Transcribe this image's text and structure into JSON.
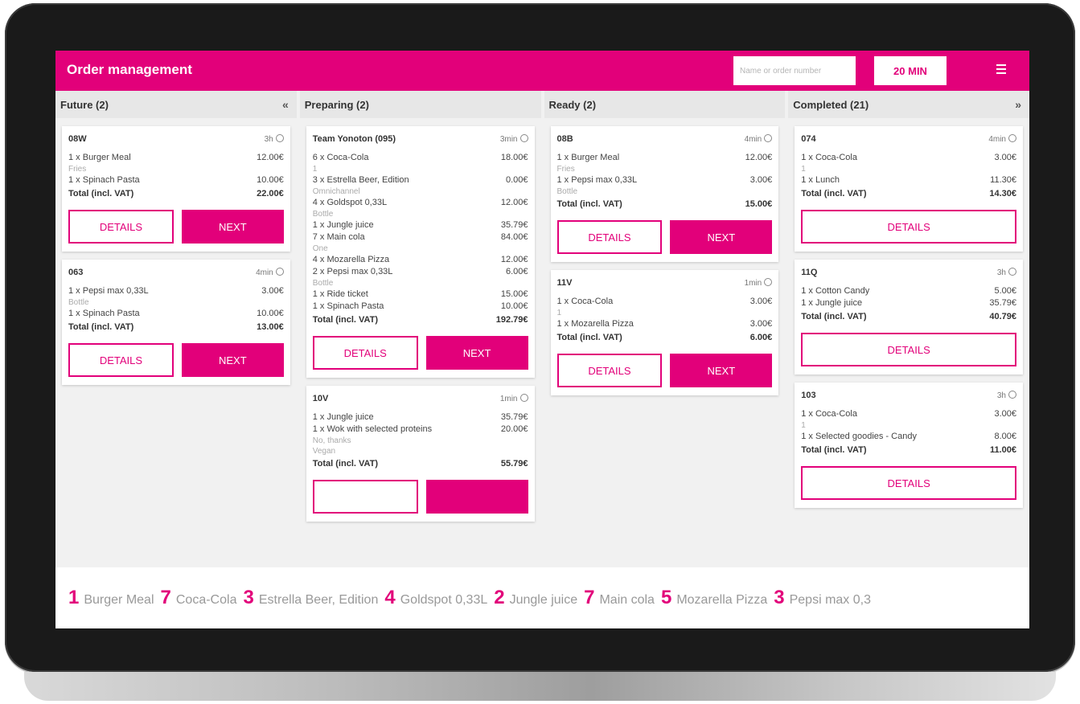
{
  "header": {
    "title": "Order management",
    "search_placeholder": "Name or order number",
    "time_button": "20 MIN",
    "menu_icon": "hamburger-icon"
  },
  "columns": [
    {
      "title": "Future (2)",
      "collapse_icon": "«",
      "cards": [
        {
          "id": "08W",
          "time": "3h",
          "lines": [
            {
              "item": "1 x Burger Meal",
              "price": "12.00€",
              "note": "Fries"
            },
            {
              "item": "1 x Spinach Pasta",
              "price": "10.00€",
              "note": ""
            }
          ],
          "total_label": "Total (incl. VAT)",
          "total": "22.00€",
          "buttons": [
            "DETAILS",
            "NEXT"
          ]
        },
        {
          "id": "063",
          "time": "4min",
          "lines": [
            {
              "item": "1 x Pepsi max 0,33L",
              "price": "3.00€",
              "note": "Bottle"
            },
            {
              "item": "1 x Spinach Pasta",
              "price": "10.00€",
              "note": ""
            }
          ],
          "total_label": "Total (incl. VAT)",
          "total": "13.00€",
          "buttons": [
            "DETAILS",
            "NEXT"
          ]
        }
      ]
    },
    {
      "title": "Preparing (2)",
      "collapse_icon": "",
      "cards": [
        {
          "id": "Team Yonoton (095)",
          "time": "3min",
          "lines": [
            {
              "item": "6 x Coca-Cola",
              "price": "18.00€",
              "note": "1"
            },
            {
              "item": "3 x Estrella Beer, Edition",
              "price": "0.00€",
              "note": "Omnichannel"
            },
            {
              "item": "4 x Goldspot 0,33L",
              "price": "12.00€",
              "note": "Bottle"
            },
            {
              "item": "1 x Jungle juice",
              "price": "35.79€",
              "note": ""
            },
            {
              "item": "7 x Main cola",
              "price": "84.00€",
              "note": "One"
            },
            {
              "item": "4 x Mozarella Pizza",
              "price": "12.00€",
              "note": ""
            },
            {
              "item": "2 x Pepsi max 0,33L",
              "price": "6.00€",
              "note": "Bottle"
            },
            {
              "item": "1 x Ride ticket",
              "price": "15.00€",
              "note": ""
            },
            {
              "item": "1 x Spinach Pasta",
              "price": "10.00€",
              "note": ""
            }
          ],
          "total_label": "Total (incl. VAT)",
          "total": "192.79€",
          "buttons": [
            "DETAILS",
            "NEXT"
          ]
        },
        {
          "id": "10V",
          "time": "1min",
          "lines": [
            {
              "item": "1 x Jungle juice",
              "price": "35.79€",
              "note": ""
            },
            {
              "item": "1 x Wok with selected proteins",
              "price": "20.00€",
              "note": "No, thanks\nVegan"
            }
          ],
          "total_label": "Total (incl. VAT)",
          "total": "55.79€",
          "buttons": [
            "",
            ""
          ]
        }
      ]
    },
    {
      "title": "Ready (2)",
      "collapse_icon": "",
      "cards": [
        {
          "id": "08B",
          "time": "4min",
          "lines": [
            {
              "item": "1 x Burger Meal",
              "price": "12.00€",
              "note": "Fries"
            },
            {
              "item": "1 x Pepsi max 0,33L",
              "price": "3.00€",
              "note": "Bottle"
            }
          ],
          "total_label": "Total (incl. VAT)",
          "total": "15.00€",
          "buttons": [
            "DETAILS",
            "NEXT"
          ]
        },
        {
          "id": "11V",
          "time": "1min",
          "lines": [
            {
              "item": "1 x Coca-Cola",
              "price": "3.00€",
              "note": "1"
            },
            {
              "item": "1 x Mozarella Pizza",
              "price": "3.00€",
              "note": ""
            }
          ],
          "total_label": "Total (incl. VAT)",
          "total": "6.00€",
          "buttons": [
            "DETAILS",
            "NEXT"
          ]
        }
      ]
    },
    {
      "title": "Completed (21)",
      "collapse_icon": "»",
      "cards": [
        {
          "id": "074",
          "time": "4min",
          "lines": [
            {
              "item": "1 x Coca-Cola",
              "price": "3.00€",
              "note": "1"
            },
            {
              "item": "1 x Lunch",
              "price": "11.30€",
              "note": ""
            }
          ],
          "total_label": "Total (incl. VAT)",
          "total": "14.30€",
          "buttons": [
            "DETAILS"
          ]
        },
        {
          "id": "11Q",
          "time": "3h",
          "lines": [
            {
              "item": "1 x Cotton Candy",
              "price": "5.00€",
              "note": ""
            },
            {
              "item": "1 x Jungle juice",
              "price": "35.79€",
              "note": ""
            }
          ],
          "total_label": "Total (incl. VAT)",
          "total": "40.79€",
          "buttons": [
            "DETAILS"
          ]
        },
        {
          "id": "103",
          "time": "3h",
          "lines": [
            {
              "item": "1 x Coca-Cola",
              "price": "3.00€",
              "note": "1"
            },
            {
              "item": "1 x Selected goodies - Candy",
              "price": "8.00€",
              "note": ""
            }
          ],
          "total_label": "Total (incl. VAT)",
          "total": "11.00€",
          "buttons": [
            "DETAILS"
          ]
        }
      ]
    }
  ],
  "ticker": [
    {
      "count": "1",
      "name": "Burger Meal"
    },
    {
      "count": "7",
      "name": "Coca-Cola"
    },
    {
      "count": "3",
      "name": "Estrella Beer, Edition"
    },
    {
      "count": "4",
      "name": "Goldspot 0,33L"
    },
    {
      "count": "2",
      "name": "Jungle juice"
    },
    {
      "count": "7",
      "name": "Main cola"
    },
    {
      "count": "5",
      "name": "Mozarella Pizza"
    },
    {
      "count": "3",
      "name": "Pepsi max 0,3"
    }
  ],
  "colors": {
    "accent": "#e2007a",
    "column_bg": "#f1f1f1"
  }
}
